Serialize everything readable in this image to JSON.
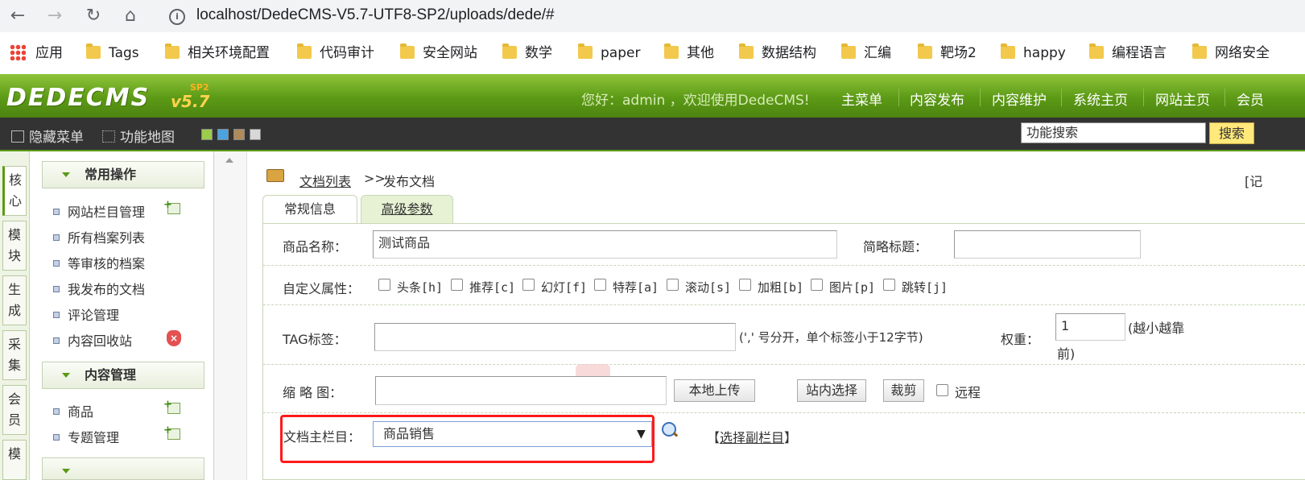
{
  "browser": {
    "address": "localhost/DedeCMS-V5.7-UTF8-SP2/uploads/dede/#",
    "bookmarks": [
      "应用",
      "Tags",
      "相关环境配置",
      "代码审计",
      "安全网站",
      "数学",
      "paper",
      "其他",
      "数据结构",
      "汇编",
      "靶场2",
      "happy",
      "编程语言",
      "网络安全"
    ]
  },
  "header": {
    "logo": "DEDECMS",
    "version": "v5.7",
    "sp": "SP2",
    "welcome": "您好：admin ，欢迎使用DedeCMS!",
    "nav": [
      "主菜单",
      "内容发布",
      "内容维护",
      "系统主页",
      "网站主页",
      "会员"
    ]
  },
  "toolbar": {
    "hide_menu": "隐藏菜单",
    "function_map": "功能地图",
    "search_placeholder": "功能搜索",
    "search_button": "搜索",
    "swatches": [
      "#9ccc4a",
      "#4aa3df",
      "#b08a5a",
      "#d8d8d8"
    ]
  },
  "vtabs": [
    "核\n心",
    "模\n块",
    "生\n成",
    "采\n集",
    "会\n员",
    "模"
  ],
  "leftmenu": {
    "section1": "常用操作",
    "items1": [
      "网站栏目管理",
      "所有档案列表",
      "等审核的档案",
      "我发布的文档",
      "评论管理",
      "内容回收站"
    ],
    "section2": "内容管理",
    "items2": [
      "商品",
      "专题管理"
    ]
  },
  "breadcrumb": {
    "link": "文档列表",
    "sep": ">>",
    "current": "发布文档",
    "right": "[记"
  },
  "tabs": [
    "常规信息",
    "高级参数"
  ],
  "form": {
    "name_label": "商品名称：",
    "name_value": "测试商品",
    "short_title_label": "简略标题：",
    "attr_label": "自定义属性：",
    "attrs": [
      "头条[h]",
      "推荐[c]",
      "幻灯[f]",
      "特荐[a]",
      "滚动[s]",
      "加粗[b]",
      "图片[p]",
      "跳转[j]"
    ],
    "tag_label": "TAG标签：",
    "tag_hint": "(',' 号分开，单个标签小于12字节)",
    "weight_label": "权重：",
    "weight_value": "1",
    "weight_hint_1": "(越小越靠",
    "weight_hint_2": "前)",
    "thumb_label": "缩 略 图：",
    "upload_button": "本地上传",
    "site_select_button": "站内选择",
    "crop_button": "裁剪",
    "remote_label": "远程",
    "category_label": "文档主栏目：",
    "category_value": "商品销售",
    "pick_sub_prefix": "【",
    "pick_sub": "选择副栏目",
    "pick_sub_suffix": "】"
  }
}
